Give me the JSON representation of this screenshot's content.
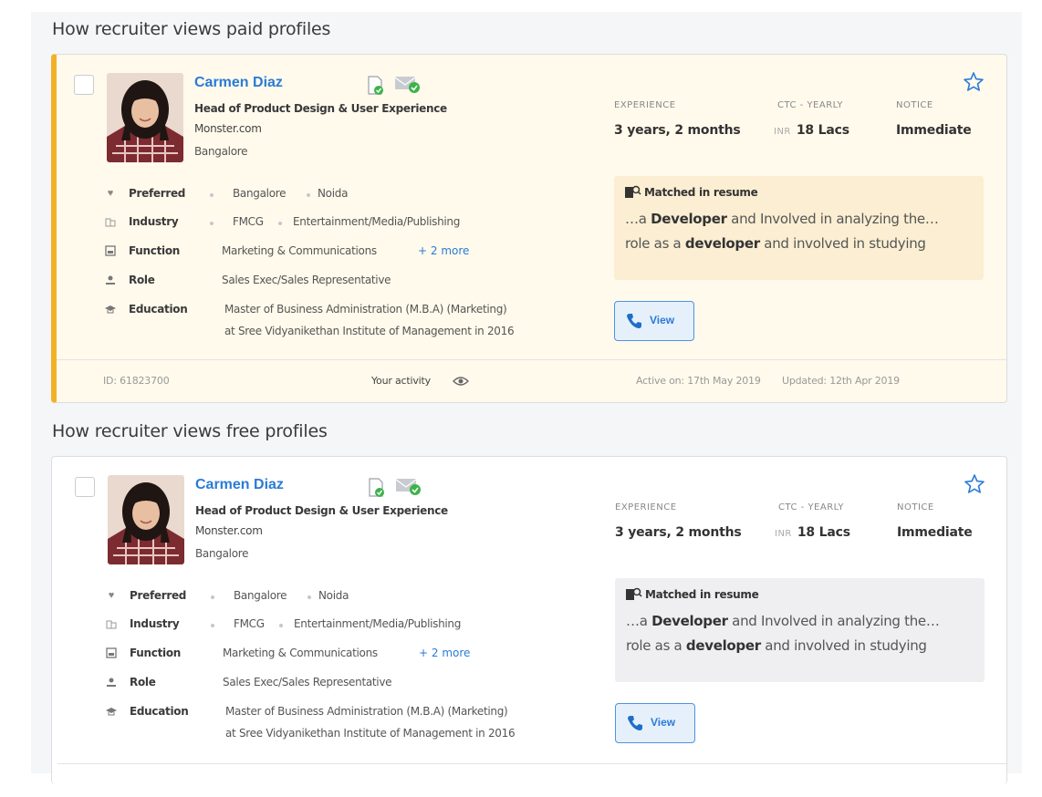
{
  "sections": [
    {
      "title": "How recruiter views paid profiles",
      "profile": {
        "name": "Carmen Diaz",
        "title": "Head of Product Design & User Experience",
        "company": "Monster.com",
        "city": "Bangalore",
        "details": {
          "preferred_label": "Preferred",
          "preferred_values": [
            "Bangalore",
            "Noida"
          ],
          "industry_label": "Industry",
          "industry_values": [
            "FMCG",
            "Entertainment/Media/Publishing"
          ],
          "function_label": "Function",
          "function_value": "Marketing & Communications",
          "function_more": "+ 2 more",
          "role_label": "Role",
          "role_value": "Sales Exec/Sales Representative",
          "education_label": "Education",
          "education_line1": "Master of Business Administration (M.B.A) (Marketing)",
          "education_line2": "at Sree Vidyanikethan Institute of Management  in 2016"
        },
        "stats": {
          "experience_label": "EXPERIENCE",
          "experience_value": "3 years, 2 months",
          "ctc_label": "CTC - YEARLY",
          "ctc_currency": "INR",
          "ctc_value": "18 Lacs",
          "notice_label": "NOTICE",
          "notice_value": "Immediate"
        },
        "match": {
          "heading": "Matched in resume",
          "line1_pre": "…a ",
          "line1_bold": "Developer",
          "line1_post": " and Involved in analyzing the…",
          "line2_pre": "role as a ",
          "line2_bold": "developer",
          "line2_post": " and involved in studying"
        },
        "view_label": "View",
        "footer": {
          "id": "ID: 61823700",
          "activity": "Your activity",
          "active_on": "Active on: 17th May 2019",
          "updated": "Updated: 12th Apr 2019"
        }
      }
    },
    {
      "title": "How recruiter views free profiles",
      "profile": {
        "name": "Carmen Diaz",
        "title": "Head of Product Design & User Experience",
        "company": "Monster.com",
        "city": "Bangalore",
        "details": {
          "preferred_label": "Preferred",
          "preferred_values": [
            "Bangalore",
            "Noida"
          ],
          "industry_label": "Industry",
          "industry_values": [
            "FMCG",
            "Entertainment/Media/Publishing"
          ],
          "function_label": "Function",
          "function_value": "Marketing & Communications",
          "function_more": "+ 2 more",
          "role_label": "Role",
          "role_value": "Sales Exec/Sales Representative",
          "education_label": "Education",
          "education_line1": "Master of Business Administration (M.B.A) (Marketing)",
          "education_line2": "at Sree Vidyanikethan Institute of Management  in 2016"
        },
        "stats": {
          "experience_label": "EXPERIENCE",
          "experience_value": "3 years, 2 months",
          "ctc_label": "CTC - YEARLY",
          "ctc_currency": "INR",
          "ctc_value": "18 Lacs",
          "notice_label": "NOTICE",
          "notice_value": "Immediate"
        },
        "match": {
          "heading": "Matched in resume",
          "line1_pre": "…a ",
          "line1_bold": "Developer",
          "line1_post": " and Involved in analyzing the…",
          "line2_pre": "role as a ",
          "line2_bold": "developer",
          "line2_post": " and involved in studying"
        },
        "view_label": "View"
      }
    }
  ],
  "colors": {
    "paid_accent": "#f2b227",
    "paid_background": "#fffaec",
    "link_blue": "#2a7bd6"
  },
  "icons": [
    "resume-verified-icon",
    "email-verified-icon",
    "star-icon",
    "heart-icon",
    "industry-icon",
    "function-icon",
    "role-icon",
    "education-icon",
    "matched-resume-icon",
    "phone-icon",
    "eye-icon"
  ]
}
